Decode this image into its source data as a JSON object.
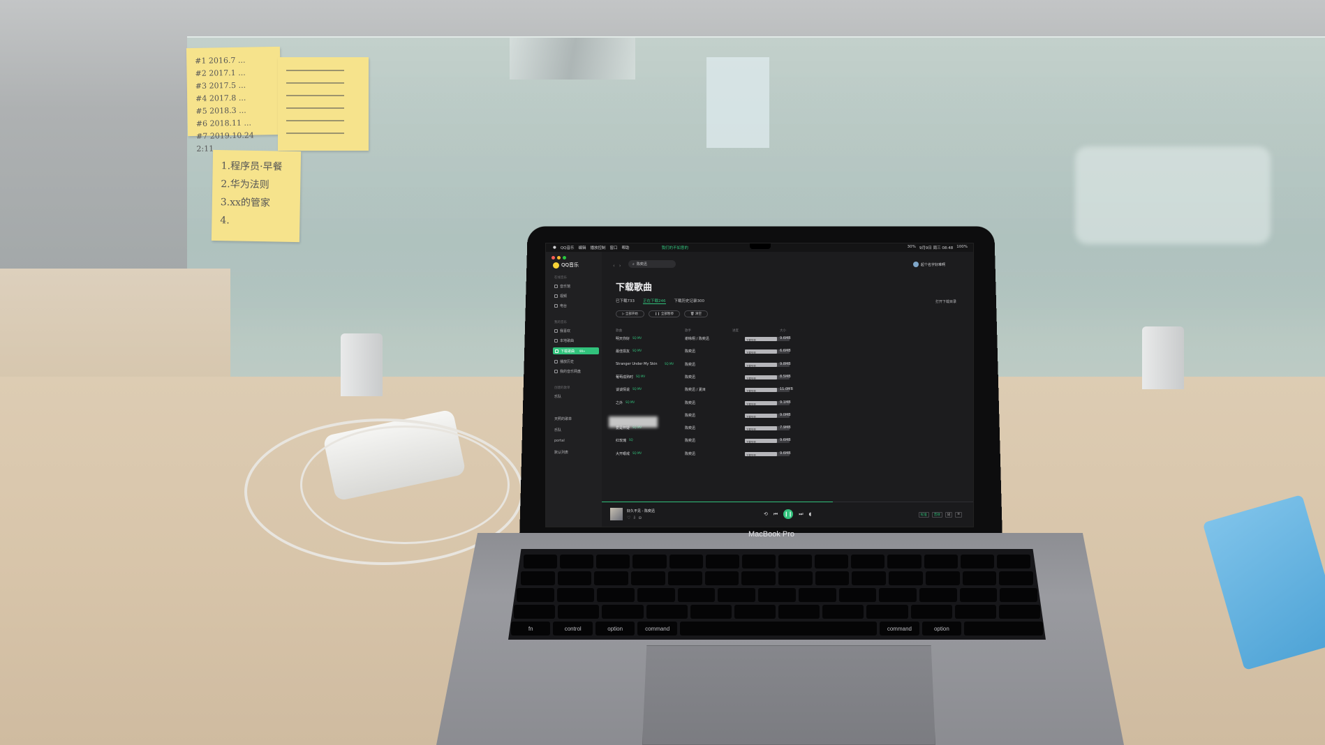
{
  "sticky_notes": {
    "note1": [
      "#1 2016.7 ...",
      "#2 2017.1 ...",
      "#3 2017.5 ...",
      "#4 2017.8 ...",
      "#5 2018.3 ...",
      "#6 2018.11 ...",
      "#7 2019.10.24 2:11"
    ],
    "note3": [
      "1.程序员·早餐",
      "2.华为法则",
      "3.xx的管家",
      "4."
    ]
  },
  "laptop": {
    "brand": "MacBook Pro",
    "keys": {
      "row_modifiers": [
        "fn",
        "control",
        "option",
        "command",
        "",
        "command",
        "option"
      ]
    }
  },
  "menubar": {
    "app": "QQ音乐",
    "items": [
      "编辑",
      "播放控制",
      "窗口",
      "帮助"
    ],
    "center_title": "我们的不如意的",
    "status": [
      "30%",
      "9月9日 周三 08:48",
      "100%"
    ]
  },
  "app": {
    "logo": "QQ音乐",
    "search_text": "陈奕迅",
    "user_name": "起个名字好难啊",
    "sidebar": {
      "section_online": "在线音乐",
      "online_items": [
        "音乐馆",
        "视频",
        "电台"
      ],
      "section_mine": "我的音乐",
      "mine_items": [
        "我喜欢",
        "本地歌曲",
        "下载歌曲",
        "播放历史",
        "我的音乐网盘"
      ],
      "active_item": "下载歌曲",
      "active_badge": "99+",
      "section_created": "创建的歌单",
      "playlists": [
        "乐队",
        "",
        "天照的歌单",
        "乐队",
        "portal",
        "默认列表"
      ]
    },
    "page_title": "下载歌曲",
    "tabs": [
      "已下载733",
      "正在下载246",
      "下载历史记录300"
    ],
    "open_folder": "打开下载目录",
    "actions": [
      "▷ 全部开始",
      "❙❙ 全部暂停",
      "🗑 清空"
    ],
    "columns": {
      "song": "歌曲",
      "artist": "歌手",
      "progress": "进度",
      "size": "大小"
    },
    "rows": [
      {
        "song": "明天你好",
        "badge": "SQ MV",
        "artist": "谢咏栩 / 陈奕迅",
        "status": "下载失败",
        "size": "9.6MB"
      },
      {
        "song": "最佳损友",
        "badge": "SQ MV",
        "artist": "陈奕迅",
        "status": "下载失败",
        "size": "6.6MB"
      },
      {
        "song": "Stranger Under My Skin",
        "badge": "SQ MV",
        "artist": "陈奕迅",
        "status": "下载失败",
        "size": "9.8MB"
      },
      {
        "song": "葡萄成熟时",
        "badge": "SQ MV",
        "artist": "陈奕迅",
        "status": "下载失败",
        "size": "8.5MB"
      },
      {
        "song": "谈谈情说",
        "badge": "SQ MV",
        "artist": "陈奕迅 / 夏目",
        "status": "下载失败",
        "size": "11.0MB"
      },
      {
        "song": "之外",
        "badge": "SQ MV",
        "artist": "陈奕迅",
        "status": "下载失败",
        "size": "9.1MB"
      },
      {
        "song": "",
        "badge": "",
        "artist": "陈奕迅",
        "status": "下载失败",
        "size": "9.0MB"
      },
      {
        "song": "爱是怀疑",
        "badge": "SQ MV",
        "artist": "陈奕迅",
        "status": "下载失败",
        "size": "7.9MB"
      },
      {
        "song": "红玫瑰",
        "badge": "SQ",
        "artist": "陈奕迅",
        "status": "下载失败",
        "size": "9.6MB"
      },
      {
        "song": "大开眼戒",
        "badge": "SQ MV",
        "artist": "陈奕迅",
        "status": "下载失败",
        "size": "9.6MB"
      }
    ],
    "player": {
      "now_playing": "好久不见 - 陈奕迅",
      "progress": 0.62,
      "right_labels": [
        "标准",
        "音效"
      ]
    }
  },
  "colors": {
    "accent": "#31c27c",
    "sticky": "#f6e38c"
  }
}
